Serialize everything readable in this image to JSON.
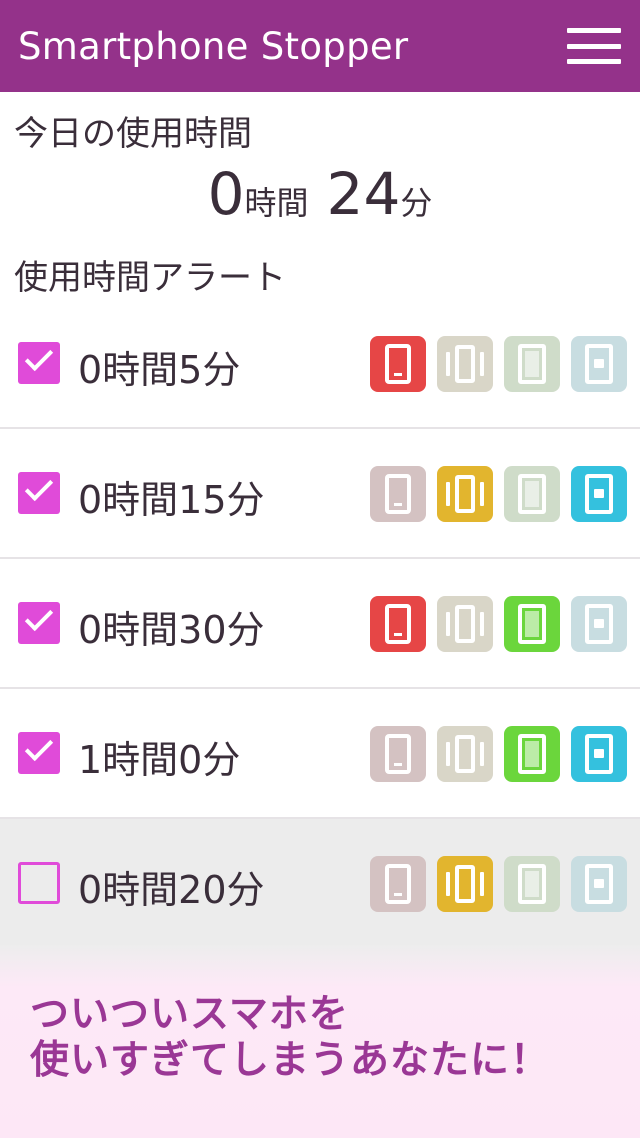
{
  "appbar": {
    "title": "Smartphone Stopper",
    "menu_icon": "hamburger-icon"
  },
  "today": {
    "label": "今日の使用時間",
    "hours": "0",
    "hours_unit": "時間",
    "minutes": "24",
    "minutes_unit": "分"
  },
  "alerts_label": "使用時間アラート",
  "alerts": [
    {
      "label": "0時間5分",
      "checked": true,
      "icons": {
        "screen": true,
        "vibrate": false,
        "flash": false,
        "notify": false
      }
    },
    {
      "label": "0時間15分",
      "checked": true,
      "icons": {
        "screen": false,
        "vibrate": true,
        "flash": false,
        "notify": true
      }
    },
    {
      "label": "0時間30分",
      "checked": true,
      "icons": {
        "screen": true,
        "vibrate": false,
        "flash": true,
        "notify": false
      }
    },
    {
      "label": "1時間0分",
      "checked": true,
      "icons": {
        "screen": false,
        "vibrate": false,
        "flash": true,
        "notify": true
      }
    },
    {
      "label": "0時間20分",
      "checked": false,
      "icons": {
        "screen": false,
        "vibrate": true,
        "flash": false,
        "notify": false
      }
    }
  ],
  "banner": {
    "line1": "ついついスマホを",
    "line2": "使いすぎてしまうあなたに！"
  },
  "colors": {
    "brand": "#94328a",
    "checkbox": "#e04bd9",
    "screen_on": "#e64646",
    "screen_off": "#d4c2c2",
    "vibrate_on": "#e2b52e",
    "vibrate_off": "#d9d6c8",
    "flash_on": "#6bd63c",
    "flash_off": "#cfdcc9",
    "notify_on": "#34c1de",
    "notify_off": "#c8dde1"
  }
}
